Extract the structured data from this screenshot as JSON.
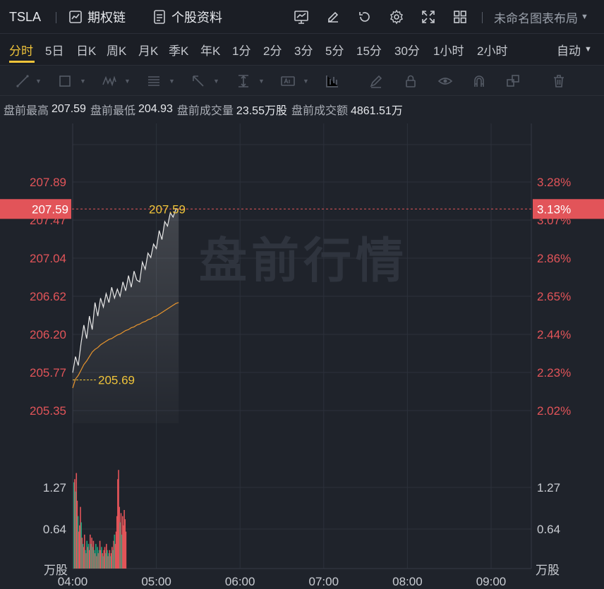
{
  "header": {
    "symbol": "TSLA",
    "options_chain": "期权链",
    "stock_profile": "个股资料",
    "layout_name": "未命名图表布局"
  },
  "periods": [
    {
      "label": "分时",
      "active": true
    },
    {
      "label": "5日"
    },
    {
      "label": "日K"
    },
    {
      "label": "周K"
    },
    {
      "label": "月K"
    },
    {
      "label": "季K"
    },
    {
      "label": "年K"
    },
    {
      "label": "1分"
    },
    {
      "label": "2分"
    },
    {
      "label": "3分"
    },
    {
      "label": "5分"
    },
    {
      "label": "15分"
    },
    {
      "label": "30分"
    },
    {
      "label": "1小时"
    },
    {
      "label": "2小时"
    }
  ],
  "auto_label": "自动",
  "draw_tools": [
    "line-tool-icon",
    "rectangle-tool-icon",
    "wave-tool-icon",
    "fib-tool-icon",
    "arrow-tool-icon",
    "measure-tool-icon",
    "text-tool-icon",
    "candle-tool-icon",
    "pen-icon",
    "lock-icon",
    "eye-icon",
    "magnet-icon",
    "copy-icon",
    "trash-icon"
  ],
  "premarket": {
    "high_label": "盘前最高",
    "high": "207.59",
    "low_label": "盘前最低",
    "low": "204.93",
    "volume_label": "盘前成交量",
    "volume": "23.55万股",
    "amount_label": "盘前成交额",
    "amount": "4861.51万"
  },
  "chart_data": {
    "type": "line",
    "watermark": "盘前行情",
    "x_ticks": [
      "04:00",
      "05:00",
      "06:00",
      "07:00",
      "08:00",
      "09:00"
    ],
    "price_ticks": [
      "207.89",
      "207.47",
      "207.04",
      "206.62",
      "206.20",
      "205.77",
      "205.35"
    ],
    "pct_ticks": [
      "3.28%",
      "3.07%",
      "2.86%",
      "2.65%",
      "2.44%",
      "2.23%",
      "2.02%"
    ],
    "ylim": [
      205.35,
      207.89
    ],
    "current_price": "207.59",
    "current_pct": "3.13%",
    "avg_price_label": "205.69",
    "volume_ticks": [
      "1.27",
      "0.64"
    ],
    "volume_unit": "万股",
    "volume_max": 1.9,
    "price_series_minutes": [
      0,
      2,
      4,
      6,
      8,
      10,
      12,
      14,
      16,
      18,
      20,
      22,
      24,
      26,
      28,
      30,
      32,
      34,
      36,
      38,
      40,
      42,
      44,
      46,
      48,
      50,
      52,
      54,
      56,
      58,
      60,
      62,
      64,
      66,
      68,
      70,
      72,
      74,
      76
    ],
    "price_series": [
      205.77,
      205.95,
      205.85,
      206.1,
      206.3,
      206.15,
      206.4,
      206.25,
      206.55,
      206.4,
      206.6,
      206.5,
      206.65,
      206.55,
      206.72,
      206.6,
      206.7,
      206.62,
      206.78,
      206.68,
      206.85,
      206.72,
      206.9,
      206.8,
      206.78,
      207.0,
      206.92,
      207.1,
      207.05,
      207.2,
      207.15,
      207.35,
      207.25,
      207.45,
      207.4,
      207.55,
      207.5,
      207.59,
      207.59
    ],
    "avg_series": [
      205.6,
      205.7,
      205.74,
      205.8,
      205.86,
      205.9,
      205.95,
      206.0,
      206.03,
      206.05,
      206.08,
      206.1,
      206.12,
      206.14,
      206.15,
      206.17,
      206.19,
      206.2,
      206.22,
      206.24,
      206.25,
      206.27,
      206.28,
      206.3,
      206.31,
      206.33,
      206.34,
      206.36,
      206.37,
      206.39,
      206.4,
      206.42,
      206.44,
      206.46,
      206.48,
      206.5,
      206.52,
      206.54,
      206.55
    ],
    "volume_bars": [
      1.4,
      1.45,
      1.25,
      1.55,
      1.1,
      0.85,
      0.6,
      0.7,
      1.0,
      0.75,
      0.5,
      0.4,
      0.35,
      0.55,
      0.3,
      0.25,
      0.45,
      0.35,
      0.4,
      0.3,
      0.55,
      0.4,
      0.5,
      0.35,
      0.45,
      0.3,
      0.25,
      0.4,
      0.2,
      0.35,
      0.25,
      0.3,
      0.45,
      0.3,
      0.35,
      0.25,
      0.2,
      0.3,
      0.35,
      0.25,
      0.4,
      0.3,
      0.2,
      0.25,
      0.3,
      0.2,
      0.25,
      0.35,
      0.3,
      0.45,
      0.55,
      0.4,
      0.6,
      0.85,
      1.45,
      1.6,
      1.0,
      0.75,
      0.9,
      0.55,
      0.85,
      0.7,
      0.95,
      0.8,
      0.6
    ],
    "volume_colors": [
      "g",
      "r",
      "g",
      "r",
      "r",
      "g",
      "r",
      "r",
      "r",
      "g",
      "r",
      "g",
      "r",
      "r",
      "g",
      "r",
      "g",
      "r",
      "g",
      "r",
      "r",
      "g",
      "r",
      "g",
      "r",
      "g",
      "r",
      "g",
      "r",
      "g",
      "r",
      "g",
      "r",
      "r",
      "g",
      "r",
      "g",
      "r",
      "r",
      "g",
      "r",
      "g",
      "r",
      "g",
      "r",
      "g",
      "r",
      "r",
      "g",
      "r",
      "g",
      "r",
      "r",
      "r",
      "r",
      "r",
      "r",
      "g",
      "r",
      "g",
      "r",
      "r",
      "r",
      "r",
      "r"
    ]
  },
  "colors": {
    "bg": "#1f232b",
    "grid": "#2c313b",
    "price_line": "#e8e8e8",
    "avg_line": "#e8952d",
    "red": "#e25459",
    "green": "#1fa37d",
    "label_yellow": "#f0c43a",
    "axis_text": "#c9ccd2",
    "red_text": "#e25459"
  }
}
